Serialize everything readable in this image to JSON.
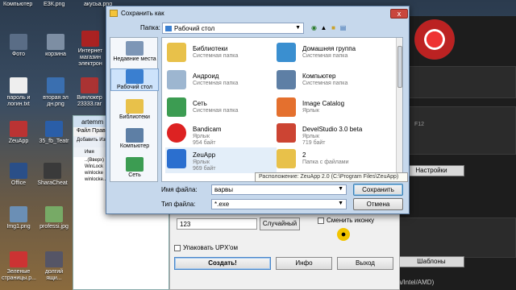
{
  "desktop": {
    "top_labels": [
      "Компьютер",
      "ЕЗК.png",
      "акусьа.png"
    ],
    "icons": [
      {
        "label": "Фото",
        "color": "#5a6d86"
      },
      {
        "label": "корзина",
        "color": "#7d8ea3"
      },
      {
        "label": "Интернет магазин электрон книга.rar",
        "color": "#a22"
      },
      {
        "label": "пароль и логин.txt",
        "color": "#eee"
      },
      {
        "label": "вторая эл дн.png",
        "color": "#3a6fb0"
      },
      {
        "label": "Винлокер 23333.rar",
        "color": "#a33"
      },
      {
        "label": "ZeuApp",
        "color": "#b33"
      },
      {
        "label": "35_fb_Teatr",
        "color": "#2a5ea8"
      },
      {
        "label": "Office",
        "color": "#2a4f88"
      },
      {
        "label": "SharaCheat",
        "color": "#3a3a3a"
      },
      {
        "label": "Img1.png",
        "color": "#6b8fb5"
      },
      {
        "label": "professi.jpg",
        "color": "#7a6"
      },
      {
        "label": "Зеленые страницы.p...",
        "color": "#c33"
      },
      {
        "label": "долгий ящи...",
        "color": "#556"
      }
    ]
  },
  "explorer": {
    "title": "artemm",
    "menu": [
      "Файл",
      "Правка"
    ],
    "tools": [
      "Добавить",
      "Изв"
    ],
    "column": "Имя",
    "rows": [
      "..(Вверх)",
      "WinLock",
      "winlocke",
      "winlocke..."
    ]
  },
  "dialog": {
    "title": "Сохранить как",
    "folder_label": "Папка:",
    "folder_value": "Рабочий стол",
    "places": [
      "Недавние места",
      "Рабочий стол",
      "Библиотеки",
      "Компьютер",
      "Сеть"
    ],
    "files": [
      {
        "name": "Библиотеки",
        "desc": "Системная папка",
        "color": "#e8c14a"
      },
      {
        "name": "Домашняя группа",
        "desc": "Системная папка",
        "color": "#3a8fd0"
      },
      {
        "name": "Андроид",
        "desc": "Системная папка",
        "color": "#9db6d0"
      },
      {
        "name": "Компьютер",
        "desc": "Системная папка",
        "color": "#5e7fa5"
      },
      {
        "name": "Сеть",
        "desc": "Системная папка",
        "color": "#3c9c52"
      },
      {
        "name": "Image Catalog",
        "desc": "Ярлык",
        "color": "#e4702e"
      },
      {
        "name": "Bandicam",
        "desc": "Ярлык",
        "size": "954 байт",
        "color": "#d22"
      },
      {
        "name": "DevelStudio 3.0 beta",
        "desc": "Ярлык",
        "size": "719 байт",
        "color": "#c43"
      },
      {
        "name": "ZeuApp",
        "desc": "Ярлык",
        "size": "969 байт",
        "color": "#2b6fcf"
      },
      {
        "name": "2",
        "desc": "Папка с файлами",
        "color": "#e8c14a"
      }
    ],
    "tooltip": "Расположение: ZeuApp 2.0 (C:\\Program Files\\ZeuApp)",
    "filename_label": "Имя файла:",
    "filename_value": "варвы",
    "filetype_label": "Тип файла:",
    "filetype_value": "*.exe",
    "save_button": "Сохранить",
    "cancel_button": "Отмена",
    "close_symbol": "x"
  },
  "zeuapp": {
    "number_value": "123",
    "random_button": "Случайный",
    "change_icon_label": "Сменить иконку",
    "upx_label": "Упаковать UPX'ом",
    "create_button": "Создать!",
    "info_button": "Инфо",
    "exit_button": "Выход"
  },
  "right_app": {
    "settings_button": "Настройки",
    "templates_button": "Шаблоны",
    "gpu_text": "er (Nvidia/Intel/AMD)",
    "hotkey_text": "F12"
  }
}
